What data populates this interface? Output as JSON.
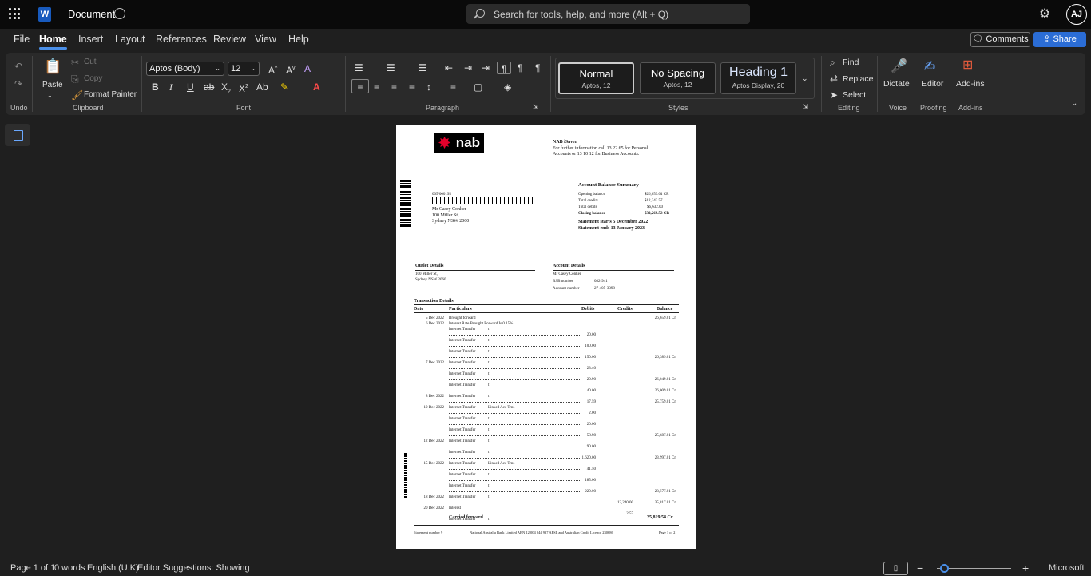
{
  "app": {
    "title": "Document",
    "user_initials": "AJ",
    "search_placeholder": "Search for tools, help, and more (Alt + Q)"
  },
  "menu": {
    "tabs": [
      "File",
      "Home",
      "Insert",
      "Layout",
      "References",
      "Review",
      "View",
      "Help"
    ],
    "active": "Home",
    "comments": "Comments",
    "share": "Share"
  },
  "ribbon": {
    "undo_label": "Undo",
    "clipboard": {
      "paste": "Paste",
      "cut": "Cut",
      "copy": "Copy",
      "format_painter": "Format Painter",
      "label": "Clipboard"
    },
    "font": {
      "family": "Aptos (Body)",
      "size": "12",
      "label": "Font"
    },
    "paragraph": {
      "label": "Paragraph"
    },
    "styles": {
      "label": "Styles",
      "items": [
        {
          "name": "Normal",
          "sub": "Aptos, 12"
        },
        {
          "name": "No Spacing",
          "sub": "Aptos, 12"
        },
        {
          "name": "Heading 1",
          "sub": "Aptos Display, 20"
        }
      ]
    },
    "editing": {
      "find": "Find",
      "replace": "Replace",
      "select": "Select",
      "label": "Editing"
    },
    "voice": {
      "dictate": "Dictate",
      "label": "Voice"
    },
    "proofing": {
      "editor": "Editor",
      "label": "Proofing"
    },
    "addins": {
      "btn": "Add-ins",
      "label": "Add-ins"
    }
  },
  "doc": {
    "brand": "nab",
    "header": {
      "product": "NAB iSaver",
      "line1": "For further information call 13 22 65 for Personal",
      "line2": "Accounts or 13 10 12 for Business Accounts."
    },
    "address": {
      "ref": "005/000195",
      "name": "Mr Casey Conker",
      "street": "100 Miller St,",
      "city": "Sydney NSW 2060"
    },
    "summary": {
      "title": "Account Balance Summary",
      "rows": [
        {
          "label": "Opening balance",
          "value": "$26,659.01 CR"
        },
        {
          "label": "Total credits",
          "value": "$12,242.57"
        },
        {
          "label": "Total debits",
          "value": "$6,632.00"
        },
        {
          "label": "Closing balance",
          "value": "$32,269.58 CR"
        }
      ],
      "starts": "Statement starts 5 December 2022",
      "ends": "Statement ends 13 January 2023"
    },
    "outlet": {
      "title": "Outlet Details",
      "street": "100 Miller St,",
      "city": "Sydney NSW 2060"
    },
    "account": {
      "title": "Account Details",
      "name": "Mr Casey Conker",
      "bsb_label": "BSB number",
      "bsb": "082-941",
      "acct_label": "Account number",
      "acct": "27-405-3398"
    },
    "transactions": {
      "title": "Transaction Details",
      "headers": {
        "date": "Date",
        "particulars": "Particulars",
        "debits": "Debits",
        "credits": "Credits",
        "balance": "Balance"
      },
      "rows": [
        {
          "date": "5 Dec 2022",
          "part": "Brought forward",
          "ref": "",
          "debit": "",
          "credit": "",
          "bal": "26,659.01 Cr"
        },
        {
          "date": "6 Dec 2022",
          "part": "Interest Rate Brought Forward Is 0.15%",
          "ref": "",
          "debit": "",
          "credit": "",
          "bal": ""
        },
        {
          "date": "",
          "part": "Internet Transfer",
          "ref": "t",
          "debit": "20.00",
          "credit": "",
          "bal": ""
        },
        {
          "date": "",
          "part": "Internet Transfer",
          "ref": "t",
          "debit": "100.00",
          "credit": "",
          "bal": ""
        },
        {
          "date": "",
          "part": "Internet Transfer",
          "ref": "t",
          "debit": "150.00",
          "credit": "",
          "bal": "26,389.01 Cr"
        },
        {
          "date": "7 Dec 2022",
          "part": "Internet Transfer",
          "ref": "t",
          "debit": "23.40",
          "credit": "",
          "bal": ""
        },
        {
          "date": "",
          "part": "Internet Transfer",
          "ref": "t",
          "debit": "20.90",
          "credit": "",
          "bal": "26,049.01 Cr"
        },
        {
          "date": "",
          "part": "Internet Transfer",
          "ref": "t",
          "debit": "40.00",
          "credit": "",
          "bal": "26,009.01 Cr"
        },
        {
          "date": "8 Dec 2022",
          "part": "Internet Transfer",
          "ref": "t",
          "debit": "17.59",
          "credit": "",
          "bal": "25,759.01 Cr"
        },
        {
          "date": "10 Dec 2022",
          "part": "Internet Transfer",
          "ref": "Linked Acc Trns",
          "debit": "2.00",
          "credit": "",
          "bal": ""
        },
        {
          "date": "",
          "part": "Internet Transfer",
          "ref": "t",
          "debit": "20.00",
          "credit": "",
          "bal": ""
        },
        {
          "date": "",
          "part": "Internet Transfer",
          "ref": "t",
          "debit": "58.98",
          "credit": "",
          "bal": "25,687.01 Cr"
        },
        {
          "date": "12 Dec 2022",
          "part": "Internet Transfer",
          "ref": "t",
          "debit": "90.00",
          "credit": "",
          "bal": ""
        },
        {
          "date": "",
          "part": "Internet Transfer",
          "ref": "t",
          "debit": "1,620.00",
          "credit": "",
          "bal": "23,997.01 Cr"
        },
        {
          "date": "15 Dec 2022",
          "part": "Internet Transfer",
          "ref": "Linked Acc Trns",
          "debit": "41.50",
          "credit": "",
          "bal": ""
        },
        {
          "date": "",
          "part": "Internet Transfer",
          "ref": "t",
          "debit": "185.00",
          "credit": "",
          "bal": ""
        },
        {
          "date": "",
          "part": "Internet Transfer",
          "ref": "t",
          "debit": "220.00",
          "credit": "",
          "bal": "23,577.01 Cr"
        },
        {
          "date": "18 Dec 2022",
          "part": "Internet Transfer",
          "ref": "t",
          "debit": "",
          "credit": "12,240.00",
          "bal": "35,817.01 Cr"
        },
        {
          "date": "20 Dec 2022",
          "part": "Interest",
          "ref": "",
          "debit": "",
          "credit": "2.57",
          "bal": ""
        },
        {
          "date": "",
          "part": "Internet Transfer",
          "ref": "t",
          "debit": "",
          "credit": "",
          "bal": ""
        }
      ],
      "carried": "Carried forward",
      "carried_bal": "35,819.58 Cr"
    },
    "footer": {
      "stmt": "Statement number 9",
      "bank": "National Australia Bank Limited ABN 12 004 044 937 AFSL and Australian Credit Licence 230686",
      "page": "Page 1 of 2"
    }
  },
  "status": {
    "page": "Page 1 of 1",
    "words": "0 words",
    "lang": "English (U.K)",
    "editor": "Editor Suggestions: Showing",
    "brand": "Microsoft"
  }
}
